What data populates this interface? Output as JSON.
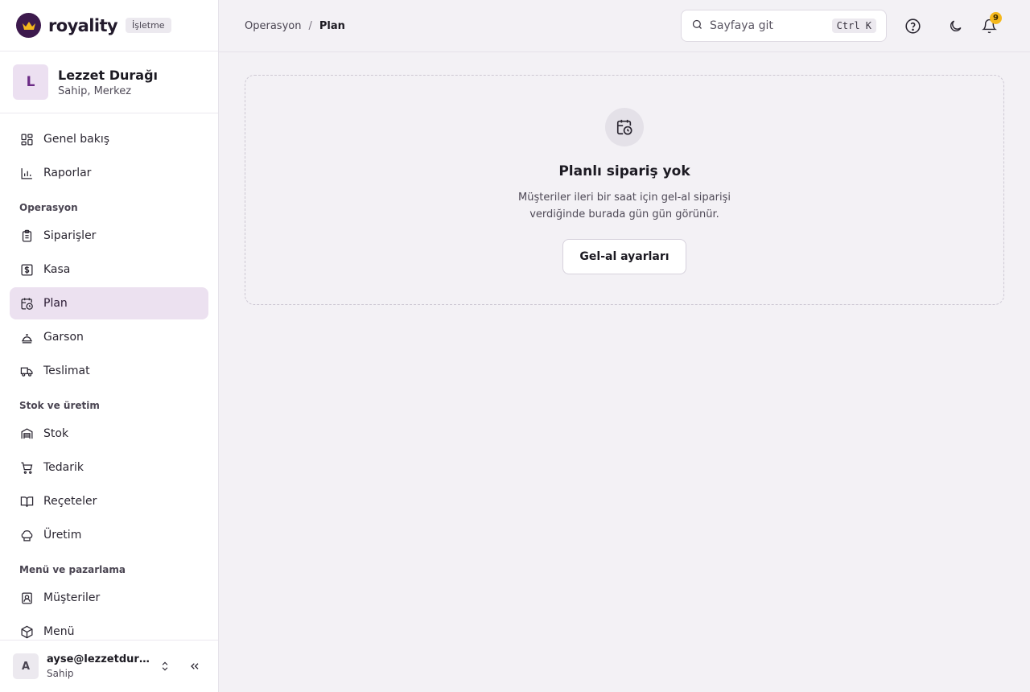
{
  "brand": {
    "name": "royality",
    "badge": "İşletme"
  },
  "org": {
    "initial": "L",
    "name": "Lezzet Durağı",
    "role": "Sahip, Merkez"
  },
  "nav": {
    "overview": "Genel bakış",
    "reports": "Raporlar",
    "section_operations": "Operasyon",
    "orders": "Siparişler",
    "cashier": "Kasa",
    "plan": "Plan",
    "waiter": "Garson",
    "delivery": "Teslimat",
    "section_stock": "Stok ve üretim",
    "stock": "Stok",
    "supply": "Tedarik",
    "recipes": "Reçeteler",
    "production": "Üretim",
    "section_menu": "Menü ve pazarlama",
    "customers": "Müşteriler",
    "menu": "Menü"
  },
  "user": {
    "initial": "A",
    "email": "ayse@lezzetduragi.com",
    "role": "Sahip"
  },
  "breadcrumb": {
    "parent": "Operasyon",
    "separator": "/",
    "current": "Plan"
  },
  "search": {
    "placeholder": "Sayfaya git",
    "shortcut": "Ctrl K"
  },
  "notifications": {
    "count": "9"
  },
  "empty_state": {
    "title": "Planlı sipariş yok",
    "description": "Müşteriler ileri bir saat için gel-al siparişi verdiğinde burada gün gün görünür.",
    "button": "Gel-al ayarları"
  },
  "colors": {
    "accent": "#6b2a85",
    "active_bg": "#ece1f0",
    "badge": "#f5b81c",
    "logo_bg": "#3d1a4d"
  }
}
